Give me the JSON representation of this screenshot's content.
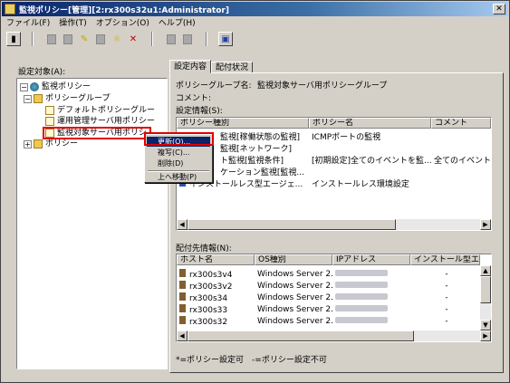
{
  "window": {
    "title": "監視ポリシー[管理][2:rx300s32u1:Administrator]",
    "close_glyph": "✕"
  },
  "menu": [
    "ファイル(F)",
    "操作(T)",
    "オプション(O)",
    "ヘルプ(H)"
  ],
  "toolbar": {
    "help_glyph": "▣"
  },
  "tree": {
    "label": "設定対象(A):",
    "nodes": {
      "root": "監視ポリシー",
      "group": "ポリシーグループ",
      "default": "デフォルトポリシーグルー",
      "ops": "運用管理サーバ用ポリシー",
      "target": "監視対象サーバ用ポリシ",
      "policy": "ポリシー"
    }
  },
  "context_menu": {
    "items": [
      "更新(O)...",
      "複写(C)...",
      "削除(D)",
      "上へ移動(P)"
    ]
  },
  "tabs": [
    "設定内容",
    "配付状況"
  ],
  "details": {
    "group_name_label": "ポリシーグループ名:",
    "group_name_value": "監視対象サーバ用ポリシーグループ",
    "comment_label": "コメント:",
    "settings_label": "設定情報(S):"
  },
  "policy_table": {
    "headers": [
      "ポリシー種別",
      "ポリシー名",
      "コメント"
    ],
    "rows": [
      [
        "監視[稼働状態の監視]",
        "ICMPポートの監視",
        ""
      ],
      [
        "監視[ネットワーク]",
        "",
        ""
      ],
      [
        "ト監視[監視条件]",
        "[初期設定]全てのイベントを監...",
        "全てのイベント"
      ],
      [
        "ケーション監視[監視...",
        "",
        ""
      ],
      [
        "インストールレス型エージェ...",
        "インストールレス環境設定",
        ""
      ]
    ]
  },
  "dist_label": "配付先情報(N):",
  "dist_table": {
    "headers": [
      "ホスト名",
      "OS種別",
      "IPアドレス",
      "インストール型エージ"
    ],
    "rows": [
      [
        "rx300s3v4",
        "Windows Server 2..."
      ],
      [
        "rx300s3v2",
        "Windows Server 2..."
      ],
      [
        "rx300s34",
        "Windows Server 2..."
      ],
      [
        "rx300s33",
        "Windows Server 2..."
      ],
      [
        "rx300s32",
        "Windows Server 2..."
      ]
    ]
  },
  "legend": "*=ポリシー設定可　-=ポリシー設定不可"
}
